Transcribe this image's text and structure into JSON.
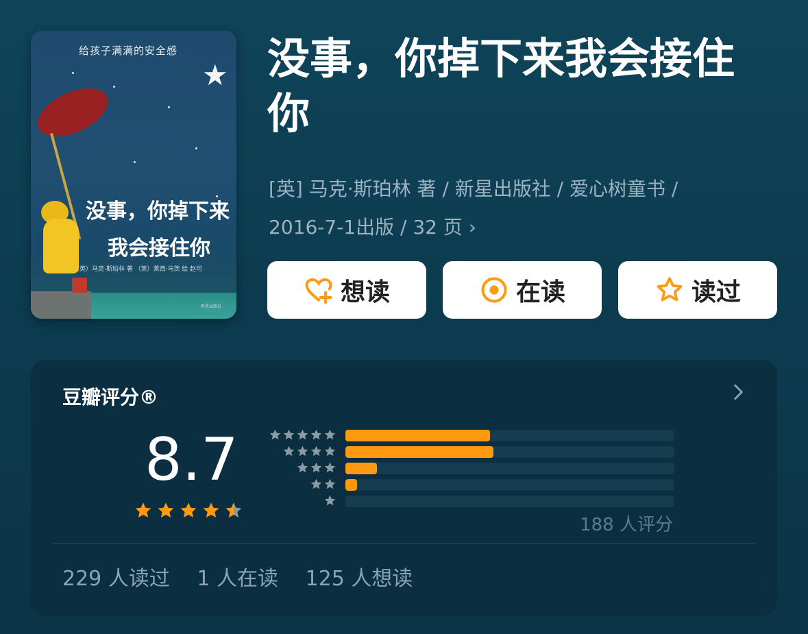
{
  "book": {
    "cover": {
      "tagline": "给孩子满满的安全感",
      "title_line1": "没事，你掉下来",
      "title_line2": "我会接住你",
      "credits": "（英）马克·斯珀林 著   （英）莱西·马茨 绘   赵可",
      "publisher": "新星出版社"
    },
    "title": "没事，你掉下来我会接住你",
    "meta_line1": "[英] 马克·斯珀林 著 / 新星出版社 / 爱心树童书 /",
    "meta_line2": "2016-7-1出版 / 32 页"
  },
  "actions": {
    "want_label": "想读",
    "reading_label": "在读",
    "read_label": "读过"
  },
  "rating": {
    "card_title": "豆瓣评分®",
    "score": "8.7",
    "score_stars": 4.5,
    "distribution": [
      {
        "stars": 5,
        "fraction": 0.44
      },
      {
        "stars": 4,
        "fraction": 0.45
      },
      {
        "stars": 3,
        "fraction": 0.095
      },
      {
        "stars": 2,
        "fraction": 0.035
      },
      {
        "stars": 1,
        "fraction": 0.0
      }
    ],
    "count_text": "188 人评分"
  },
  "stats": {
    "read": "229 人读过",
    "reading": "1 人在读",
    "want": "125 人想读"
  },
  "colors": {
    "accent": "#ff9a12",
    "background": "#0f4459",
    "card": "#0b2e40",
    "track": "#163d4f",
    "muted_star": "#8a9ba5"
  }
}
